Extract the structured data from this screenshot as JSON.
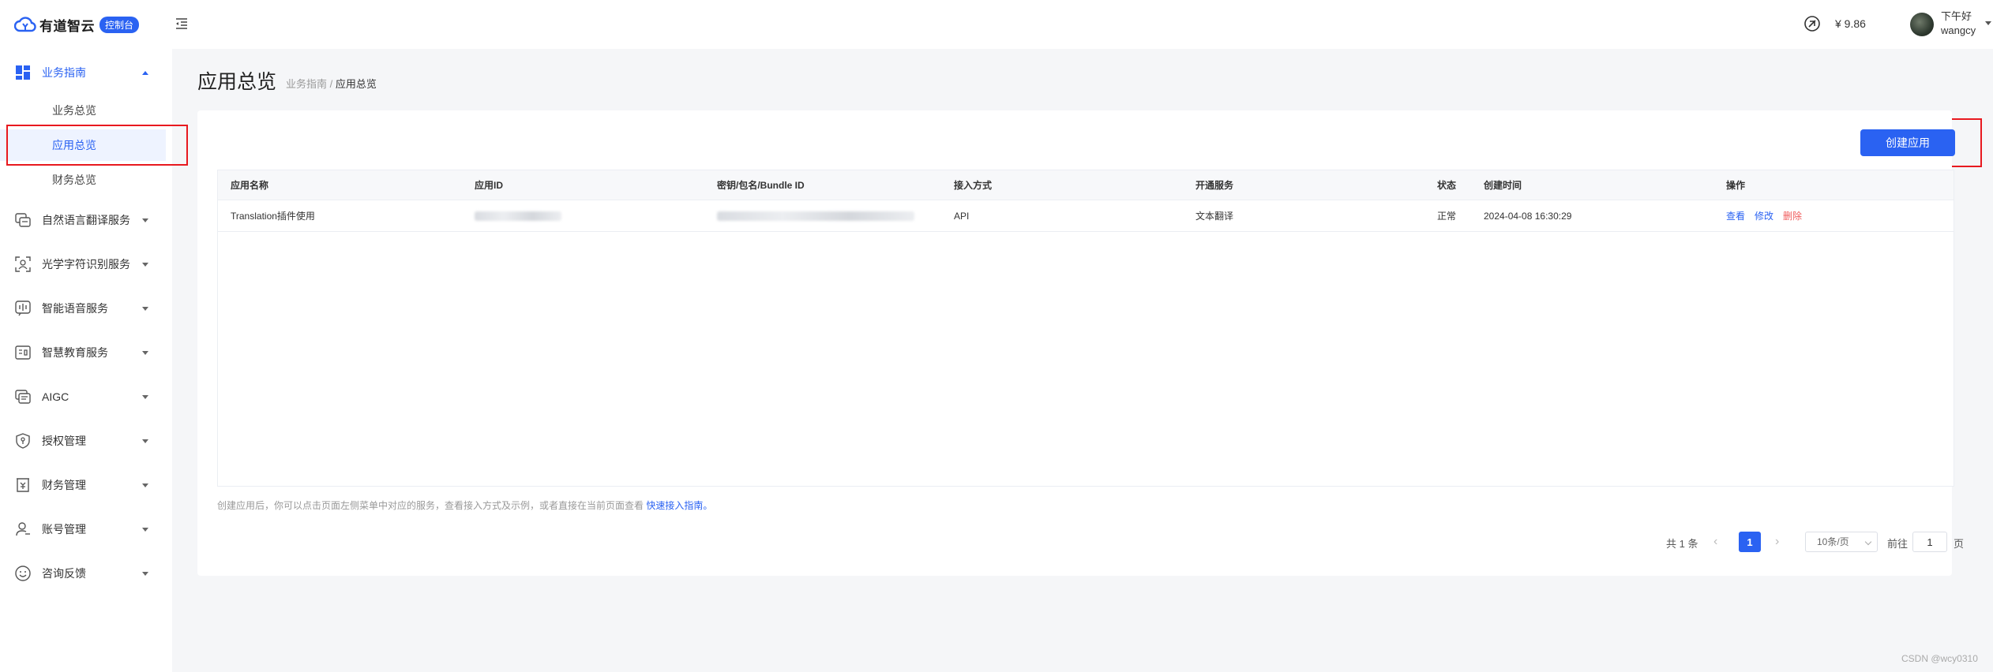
{
  "header": {
    "logo_text": "有道智云",
    "logo_badge": "控制台",
    "balance": "¥ 9.86",
    "greeting": "下午好",
    "username": "wangcy"
  },
  "sidebar": {
    "business_guide": {
      "label": "业务指南",
      "items": [
        {
          "label": "业务总览"
        },
        {
          "label": "应用总览"
        },
        {
          "label": "财务总览"
        }
      ]
    },
    "groups": [
      {
        "label": "自然语言翻译服务",
        "icon": "translate-icon"
      },
      {
        "label": "光学字符识别服务",
        "icon": "ocr-scan-icon"
      },
      {
        "label": "智能语音服务",
        "icon": "voice-icon"
      },
      {
        "label": "智慧教育服务",
        "icon": "education-icon"
      },
      {
        "label": "AIGC",
        "icon": "aigc-icon"
      },
      {
        "label": "授权管理",
        "icon": "shield-icon"
      },
      {
        "label": "财务管理",
        "icon": "finance-icon"
      },
      {
        "label": "账号管理",
        "icon": "user-icon"
      },
      {
        "label": "咨询反馈",
        "icon": "feedback-icon"
      }
    ]
  },
  "main": {
    "title": "应用总览",
    "breadcrumb": {
      "parent": "业务指南",
      "separator": "/",
      "current": "应用总览"
    },
    "create_button": "创建应用",
    "table": {
      "headers": [
        "应用名称",
        "应用ID",
        "密钥/包名/Bundle ID",
        "接入方式",
        "开通服务",
        "状态",
        "创建时间",
        "操作"
      ],
      "rows": [
        {
          "name": "Translation插件使用",
          "access": "API",
          "service": "文本翻译",
          "status": "正常",
          "created": "2024-04-08 16:30:29",
          "ops": {
            "view": "查看",
            "edit": "修改",
            "delete": "删除"
          }
        }
      ]
    },
    "hint": {
      "text": "创建应用后，你可以点击页面左侧菜单中对应的服务，查看接入方式及示例，或者直接在当前页面查看",
      "link": "快速接入指南。"
    },
    "pagination": {
      "total": "共 1 条",
      "current_page": "1",
      "page_size": "10条/页",
      "goto_prefix": "前往",
      "goto_value": "1",
      "goto_suffix": "页"
    }
  },
  "watermark": "CSDN @wcy0310",
  "colors": {
    "accent": "#2a62f2",
    "danger": "#f05c5c",
    "highlight_box": "#e8191f"
  }
}
